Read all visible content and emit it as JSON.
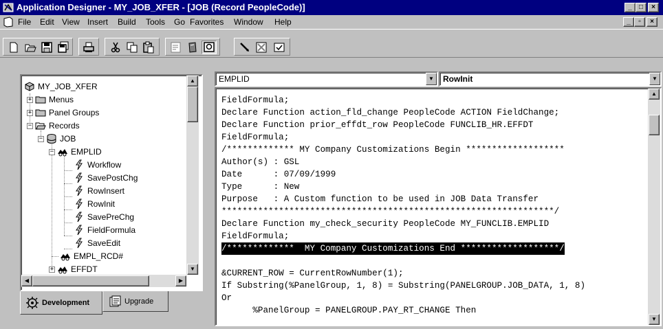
{
  "window": {
    "title": "Application Designer - MY_JOB_XFER - [JOB (Record PeopleCode)]",
    "controls": {
      "minimize": "_",
      "maximize": "□",
      "close": "×"
    },
    "doc_controls": {
      "minimize": "_",
      "restore": "▫",
      "close": "×"
    }
  },
  "menu": [
    "File",
    "Edit",
    "View",
    "Insert",
    "Build",
    "Tools",
    "Go",
    "Favorites",
    "Window",
    "Help"
  ],
  "toolbar": {
    "icons": [
      "new-icon",
      "open-icon",
      "save-icon",
      "save-all-icon",
      "print-icon",
      "cut-icon",
      "copy-icon",
      "paste-icon",
      "properties-icon",
      "project-icon",
      "find-icon",
      "validate-icon",
      "compare-icon",
      "check-icon"
    ]
  },
  "tree": {
    "root": "MY_JOB_XFER",
    "items": [
      {
        "label": "MY_JOB_XFER"
      },
      {
        "label": "Menus",
        "toggle": "+"
      },
      {
        "label": "Panel Groups",
        "toggle": "+"
      },
      {
        "label": "Records",
        "toggle": "−"
      },
      {
        "label": "JOB",
        "toggle": "−"
      },
      {
        "label": "EMPLID",
        "toggle": "−"
      },
      {
        "label": "Workflow"
      },
      {
        "label": "SavePostChg"
      },
      {
        "label": "RowInsert"
      },
      {
        "label": "RowInit"
      },
      {
        "label": "SavePreChg"
      },
      {
        "label": "FieldFormula"
      },
      {
        "label": "SaveEdit"
      },
      {
        "label": "EMPL_RCD#"
      },
      {
        "label": "EFFDT",
        "toggle": "+"
      }
    ]
  },
  "tabs": [
    {
      "label": "Development",
      "active": true
    },
    {
      "label": "Upgrade",
      "active": false
    }
  ],
  "editor": {
    "field_select": "EMPLID",
    "event_select": "RowInit",
    "lines": [
      "FieldFormula;",
      "Declare Function action_fld_change PeopleCode ACTION FieldChange;",
      "Declare Function prior_effdt_row PeopleCode FUNCLIB_HR.EFFDT",
      "FieldFormula;",
      "/************* MY Company Customizations Begin *******************",
      "Author(s) : GSL",
      "Date      : 07/09/1999",
      "Type      : New",
      "Purpose   : A Custom function to be used in JOB Data Transfer",
      "****************************************************************/",
      "Declare Function my_check_security PeopleCode MY_FUNCLIB.EMPLID",
      "FieldFormula;",
      "/*************  MY Company Customizations End *******************/",
      "",
      "&CURRENT_ROW = CurrentRowNumber(1);",
      "If Substring(%PanelGroup, 1, 8) = Substring(PANELGROUP.JOB_DATA, 1, 8)",
      "Or",
      "      %PanelGroup = PANELGROUP.PAY_RT_CHANGE Then"
    ],
    "highlighted_line": 12
  },
  "colors": {
    "titlebar": "#000080",
    "face": "#c0c0c0",
    "highlight_bg": "#000000"
  }
}
